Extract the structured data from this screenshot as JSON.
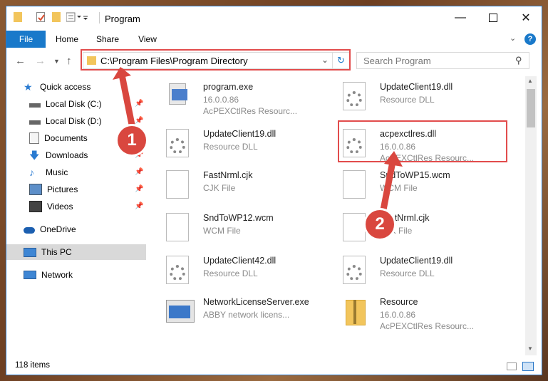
{
  "window": {
    "title": "Program"
  },
  "ribbon": {
    "tabs": [
      "File",
      "Home",
      "Share",
      "View"
    ]
  },
  "address": {
    "path": "C:\\Program Files\\Program Directory"
  },
  "search": {
    "placeholder": "Search Program"
  },
  "sidebar": {
    "items": [
      {
        "label": "Quick access",
        "icon": "star-icon"
      },
      {
        "label": "Local Disk (C:)",
        "icon": "drive-icon",
        "pinned": true
      },
      {
        "label": "Local Disk (D:)",
        "icon": "drive-icon",
        "pinned": true
      },
      {
        "label": "Documents",
        "icon": "documents-icon",
        "pinned": true
      },
      {
        "label": "Downloads",
        "icon": "download-icon",
        "pinned": true
      },
      {
        "label": "Music",
        "icon": "music-icon",
        "pinned": true
      },
      {
        "label": "Pictures",
        "icon": "pictures-icon",
        "pinned": true
      },
      {
        "label": "Videos",
        "icon": "videos-icon",
        "pinned": true
      },
      {
        "label": "OneDrive",
        "icon": "onedrive-icon"
      },
      {
        "label": "This PC",
        "icon": "pc-icon",
        "selected": true
      },
      {
        "label": "Network",
        "icon": "network-icon"
      }
    ]
  },
  "files": [
    {
      "name": "program.exe",
      "line2": "16.0.0.86",
      "line3": "AcPEXCtlRes Resourc...",
      "icon": "exe-icon"
    },
    {
      "name": "UpdateClient19.dll",
      "line2": "Resource DLL",
      "line3": "",
      "icon": "dll-gear-icon"
    },
    {
      "name": "UpdateClient19.dll",
      "line2": "Resource DLL",
      "line3": "",
      "icon": "dll-gear-icon"
    },
    {
      "name": "acpexctlres.dll",
      "line2": "16.0.0.86",
      "line3": "AcPEXCtlRes Resourc...",
      "icon": "dll-gear-icon"
    },
    {
      "name": "FastNrml.cjk",
      "line2": "CJK File",
      "line3": "",
      "icon": "blank-file-icon"
    },
    {
      "name": "SndToWP15.wcm",
      "line2": "WCM File",
      "line3": "",
      "icon": "blank-file-icon"
    },
    {
      "name": "SndToWP12.wcm",
      "line2": "WCM File",
      "line3": "",
      "icon": "blank-file-icon"
    },
    {
      "name": "FastNrml.cjk",
      "line2": "CJK File",
      "line3": "",
      "icon": "blank-file-icon"
    },
    {
      "name": "UpdateClient42.dll",
      "line2": "Resource DLL",
      "line3": "",
      "icon": "dll-gear-icon"
    },
    {
      "name": "UpdateClient19.dll",
      "line2": "Resource DLL",
      "line3": "",
      "icon": "dll-gear-icon"
    },
    {
      "name": "NetworkLicenseServer.exe",
      "line2": "ABBY network licens...",
      "line3": "",
      "icon": "exe-window-icon"
    },
    {
      "name": "Resource",
      "line2": "16.0.0.86",
      "line3": "AcPEXCtlRes Resourc...",
      "icon": "zip-folder-icon"
    }
  ],
  "annotations": [
    {
      "number": "1",
      "color": "#d9473f"
    },
    {
      "number": "2",
      "color": "#d9473f"
    }
  ],
  "status": {
    "item_count": "118 items"
  },
  "colors": {
    "accent": "#1979ca",
    "highlight": "#e24c4c"
  }
}
